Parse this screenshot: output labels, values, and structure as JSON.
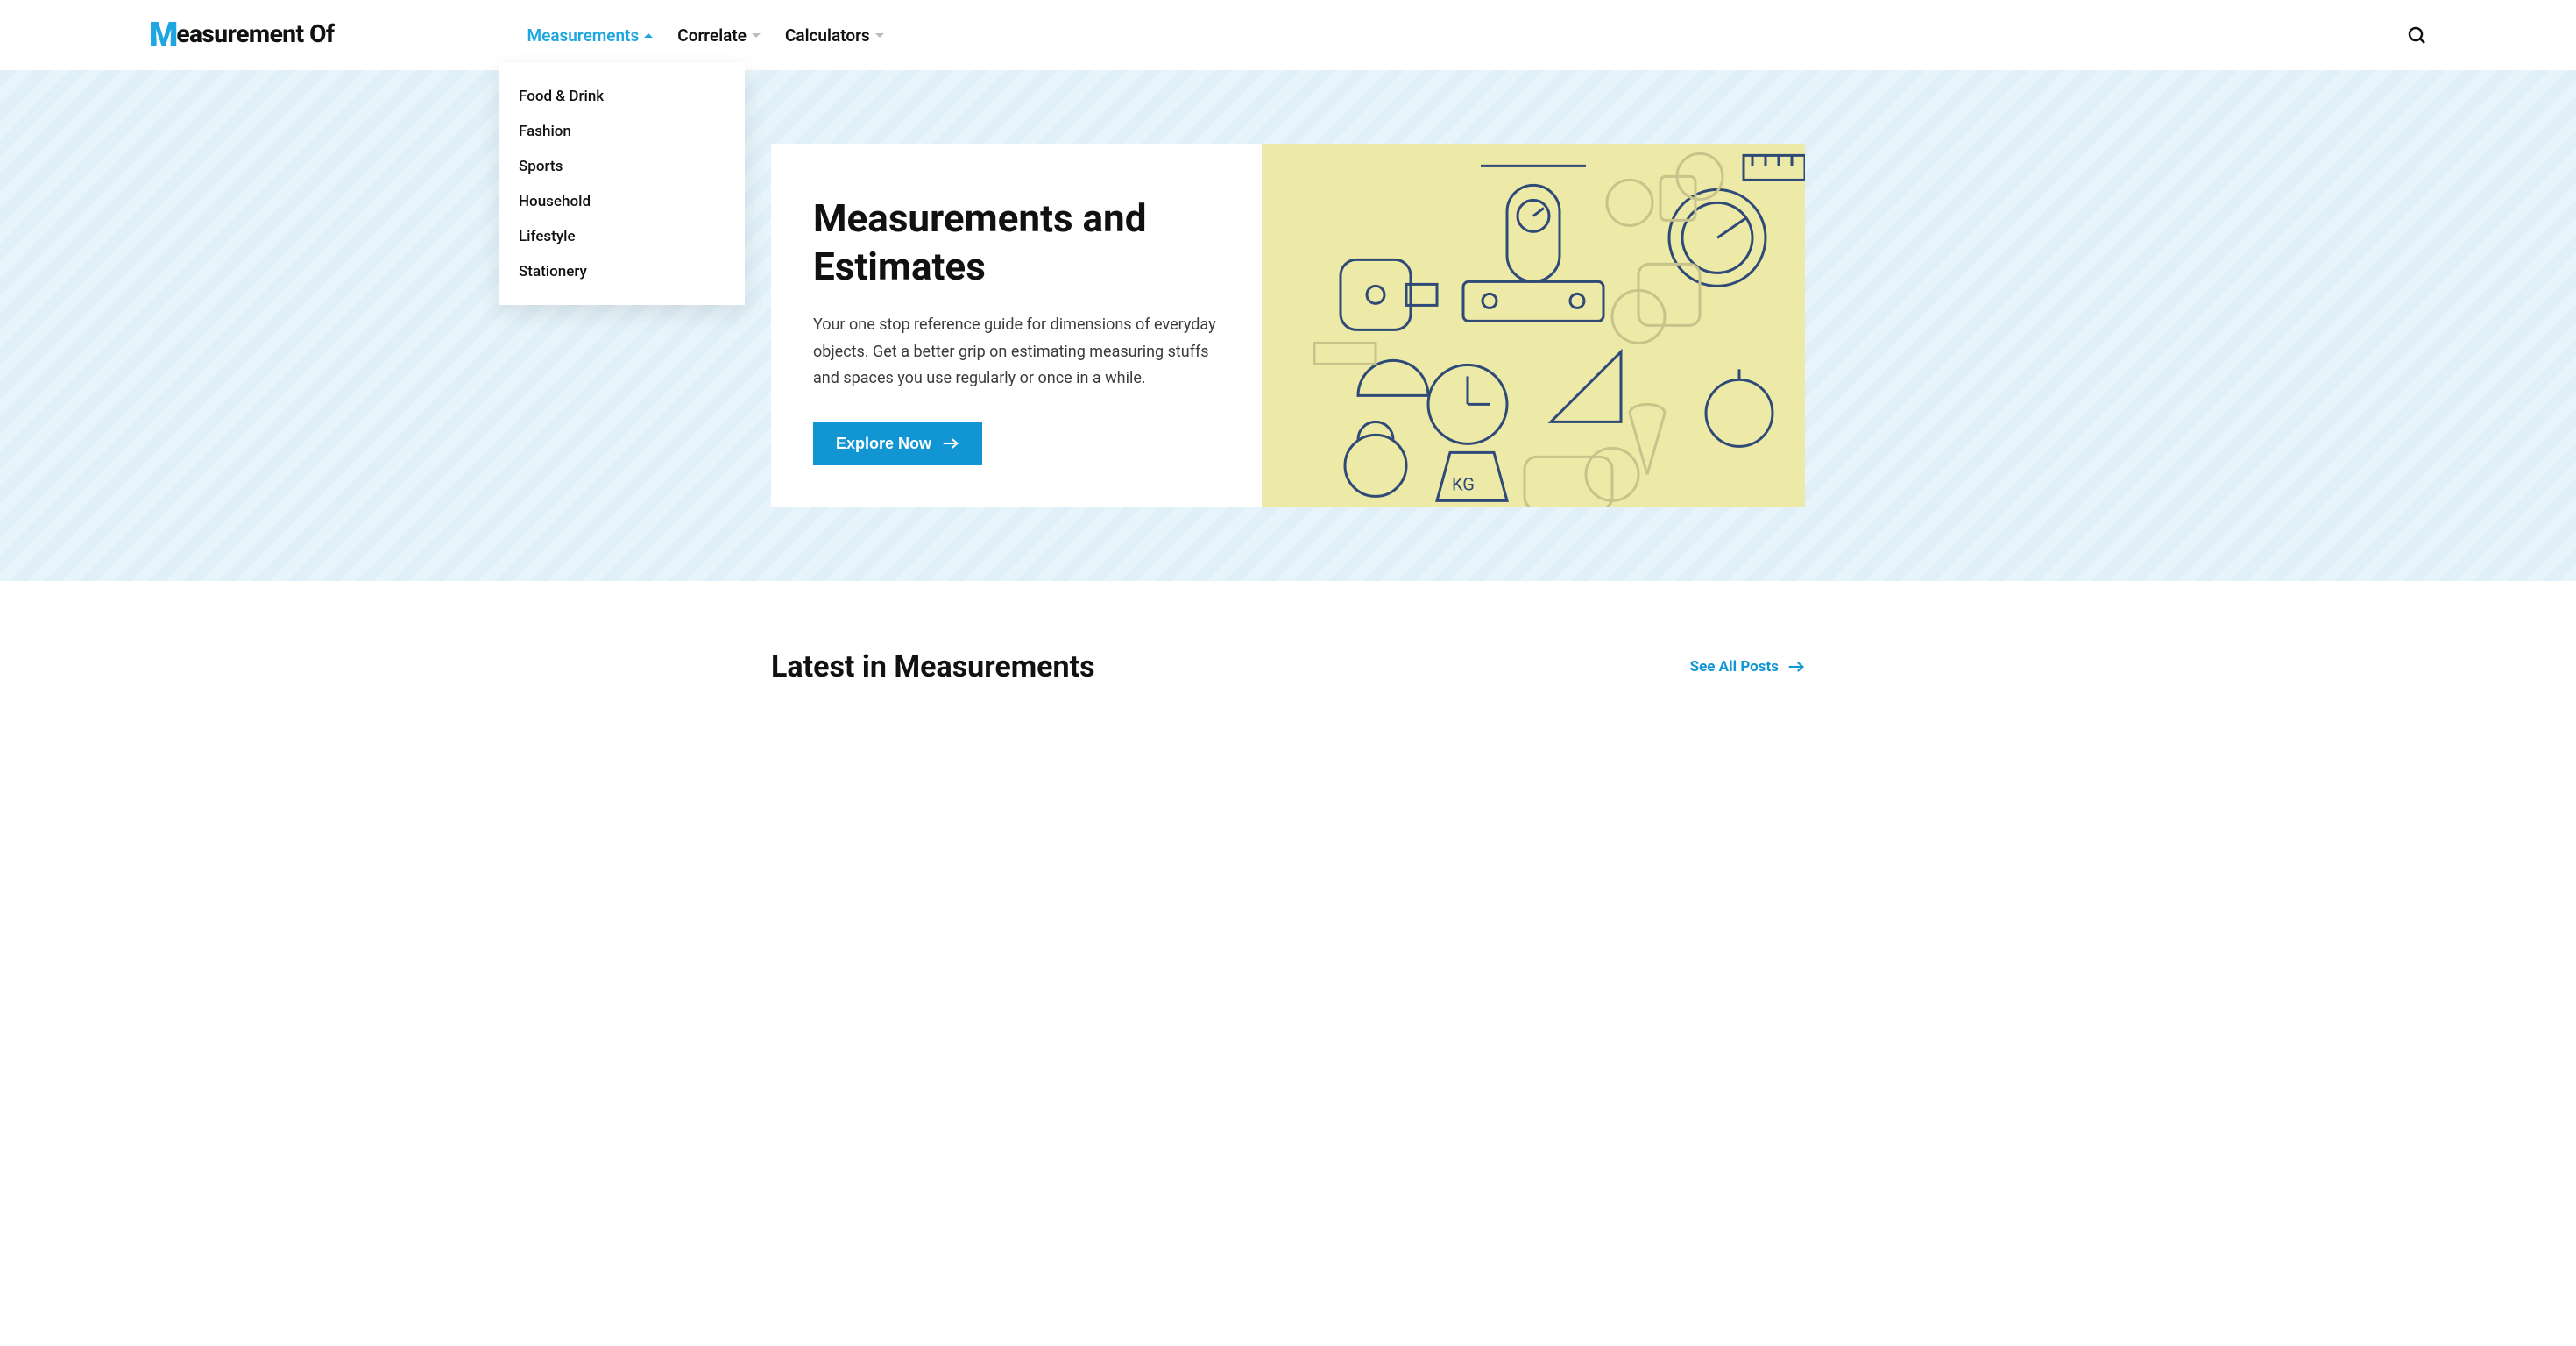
{
  "brand": {
    "prefix": "M",
    "rest": "easurement Of"
  },
  "nav": {
    "items": [
      {
        "label": "Measurements",
        "active": true
      },
      {
        "label": "Correlate",
        "active": false
      },
      {
        "label": "Calculators",
        "active": false
      }
    ]
  },
  "dropdown": {
    "items": [
      "Food & Drink",
      "Fashion",
      "Sports",
      "Household",
      "Lifestyle",
      "Stationery"
    ]
  },
  "hero": {
    "title": "Measurements and Estimates",
    "body": "Your one stop reference guide for dimensions of everyday objects. Get a better grip on estimating measuring stuffs and spaces you use regularly or once in a while.",
    "cta": "Explore Now"
  },
  "latest": {
    "heading": "Latest in Measurements",
    "see_all": "See All Posts"
  },
  "colors": {
    "accent": "#1296d3",
    "nav_active": "#1ea6e0",
    "hero_bg": "#e7f3fa",
    "illus_bg": "#edeaa8"
  }
}
